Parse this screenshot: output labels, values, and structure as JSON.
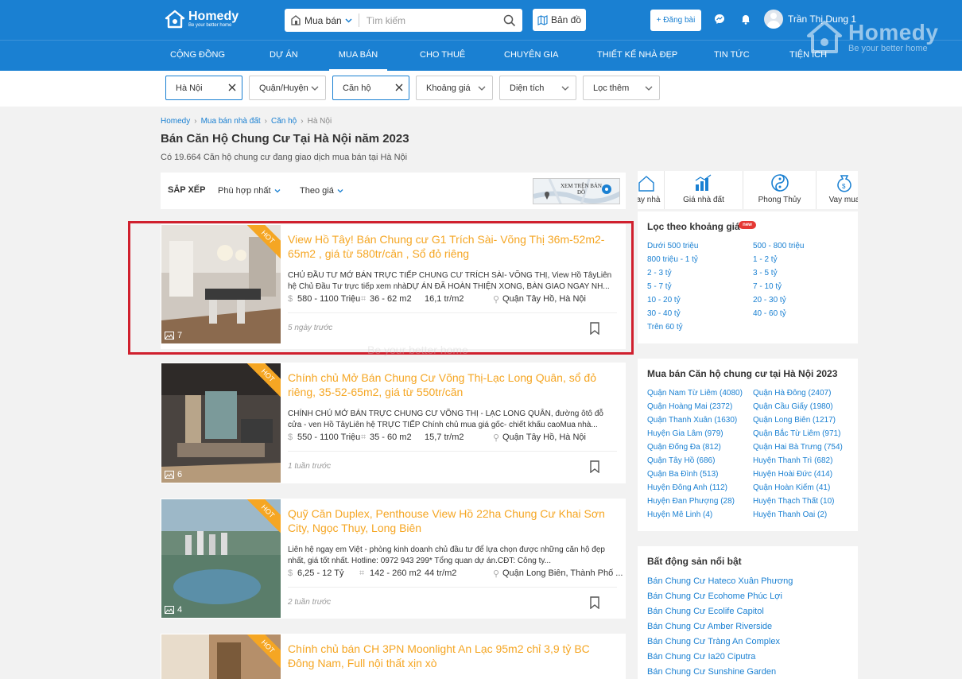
{
  "header": {
    "logo_text": "Homedy",
    "logo_sub": "Be your better home",
    "search_type": "Mua bán",
    "search_placeholder": "Tìm kiếm",
    "map_button": "Bản đồ",
    "post_button": "+ Đăng bài",
    "user_name": "Trần Thị Dung 1"
  },
  "watermark": {
    "title": "Homedy",
    "sub": "Be your better home"
  },
  "nav": [
    "CỘNG ĐỒNG",
    "DỰ ÁN",
    "MUA BÁN",
    "CHO THUÊ",
    "CHUYÊN GIA",
    "THIẾT KẾ NHÀ ĐẸP",
    "TIN TỨC",
    "TIỆN ÍCH"
  ],
  "filters": [
    "Hà Nội",
    "Quận/Huyện",
    "Căn hộ",
    "Khoảng giá",
    "Diện tích",
    "Lọc thêm"
  ],
  "breadcrumb": [
    "Homedy",
    "Mua bán nhà đất",
    "Căn hộ",
    "Hà Nội"
  ],
  "page": {
    "title": "Bán Căn Hộ Chung Cư Tại Hà Nội năm 2023",
    "subtitle": "Có 19.664 Căn hộ chung cư đang giao dịch mua bán tại Hà Nội"
  },
  "sort": {
    "label": "SẮP XẾP",
    "option1": "Phù hợp nhất",
    "option2": "Theo giá",
    "map_thumb_text": "XEM TRÊN BẢN ĐỒ"
  },
  "listings": [
    {
      "title": "View Hồ Tây! Bán Chung cư G1 Trích Sài- Võng Thị 36m-52m2-65m2 , giá từ 580tr/căn , Sổ đỏ riêng",
      "desc": "CHỦ ĐẦU TƯ MỞ BÁN TRỰC TIẾP CHUNG CƯ TRÍCH SÀI- VÕNG THỊ, View Hồ TâyLiên hệ Chủ Đầu Tư trực tiếp xem nhàDỰ ÁN ĐÃ HOÀN THIỆN XONG, BÀN GIAO NGAY NH...",
      "price": "580 - 1100 Triệu",
      "area": "36 - 62 m2",
      "unit_price": "16,1 tr/m2",
      "location": "Quận Tây Hồ, Hà Nội",
      "time": "5 ngày trước",
      "photos": "7",
      "hot": "HOT"
    },
    {
      "title": "Chính chủ Mở Bán Chung Cư Võng Thị-Lạc Long Quân, sổ đỏ riêng, 35-52-65m2, giá từ 550tr/căn",
      "desc": "CHÍNH CHỦ MỞ BÁN TRỰC CHUNG CƯ VÕNG THỊ - LẠC LONG QUÂN, đường ôtô đỗ cửa - ven Hồ TâyLiên hệ TRỰC TIẾP Chính chủ mua giá gốc- chiết khấu caoMua nhà...",
      "price": "550 - 1100 Triệu",
      "area": "35 - 60 m2",
      "unit_price": "15,7 tr/m2",
      "location": "Quận Tây Hồ, Hà Nội",
      "time": "1 tuần trước",
      "photos": "6",
      "hot": "HOT"
    },
    {
      "title": "Quỹ Căn Duplex, Penthouse View Hồ 22ha Chung Cư Khai Sơn City, Ngọc Thụy, Long Biên",
      "desc": "Liên hệ ngay em Việt - phòng kinh doanh chủ đầu tư để lựa chọn được những căn hộ đẹp nhất, giá tốt nhất. Hotline: 0972 943 299* Tổng quan dự án.CĐT: Công ty...",
      "price": "6,25 - 12 Tỷ",
      "area": "142 - 260 m2",
      "unit_price": "44 tr/m2",
      "location": "Quận Long Biên, Thành Phố ...",
      "time": "2 tuần trước",
      "photos": "4",
      "hot": "HOT"
    },
    {
      "title": "Chính chủ bán CH 3PN Moonlight An Lạc 95m2 chỉ 3,9 tỷ BC Đông Nam, Full nội thất xịn xò",
      "hot": "HOT"
    }
  ],
  "tools": [
    "Vay nhà",
    "Giá nhà đất",
    "Phong Thủy",
    "Vay mua"
  ],
  "price_filter": {
    "title": "Lọc theo khoảng giá",
    "badge": "new",
    "left": [
      "Dưới 500 triệu",
      "800 triệu - 1 tỷ",
      "2 - 3 tỷ",
      "5 - 7 tỷ",
      "10 - 20 tỷ",
      "30 - 40 tỷ",
      "Trên 60 tỷ"
    ],
    "right": [
      "500 - 800 triệu",
      "1 - 2 tỷ",
      "3 - 5 tỷ",
      "7 - 10 tỷ",
      "20 - 30 tỷ",
      "40 - 60 tỷ"
    ]
  },
  "districts": {
    "title": "Mua bán Căn hộ chung cư tại Hà Nội 2023",
    "left": [
      "Quận Nam Từ Liêm (4080)",
      "Quận Hoàng Mai (2372)",
      "Quận Thanh Xuân (1630)",
      "Huyện Gia Lâm (979)",
      "Quận Đống Đa (812)",
      "Quận Tây Hồ (686)",
      "Quận Ba Đình (513)",
      "Huyện Đông Anh (112)",
      "Huyện Đan Phượng (28)",
      "Huyện Mê Linh (4)"
    ],
    "right": [
      "Quận Hà Đông (2407)",
      "Quận Cầu Giấy (1980)",
      "Quận Long Biên (1217)",
      "Quận Bắc Từ Liêm (971)",
      "Quận Hai Bà Trưng (754)",
      "Huyện Thanh Trì (682)",
      "Huyện Hoài Đức (414)",
      "Quận Hoàn Kiếm (41)",
      "Huyện Thạch Thất (10)",
      "Huyện Thanh Oai (2)"
    ]
  },
  "featured": {
    "title": "Bất động sản nổi bật",
    "items": [
      "Bán Chung Cư Hateco Xuân Phương",
      "Bán Chung Cư Ecohome Phúc Lợi",
      "Bán Chung Cư Ecolife Capitol",
      "Bán Chung Cư Amber Riverside",
      "Bán Chung Cư Tràng An Complex",
      "Bán Chung Cư Ia20 Ciputra",
      "Bán Chung Cư Sunshine Garden"
    ]
  },
  "bg_watermark": "Be your better home",
  "colors": {
    "brand": "#1a80d2",
    "accent": "#f5a623",
    "highlight": "#d0202e"
  }
}
